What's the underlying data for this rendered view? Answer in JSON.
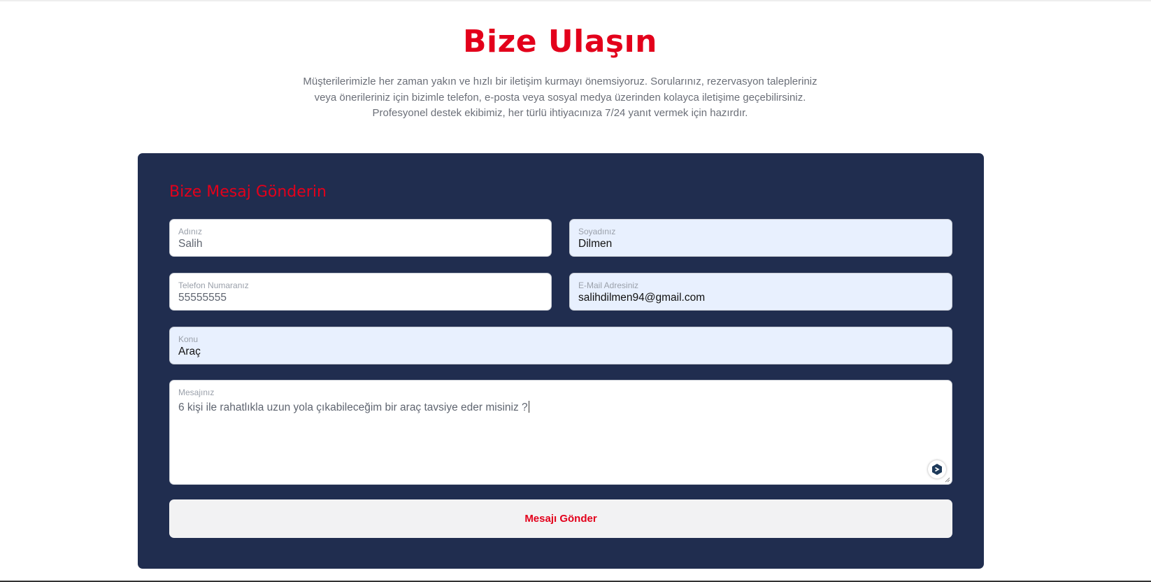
{
  "header": {
    "title": "Bize Ulaşın",
    "intro_lines": [
      "Müşterilerimizle her zaman yakın ve hızlı bir iletişim kurmayı önemsiyoruz. Sorularınız, rezervasyon talepleriniz",
      "veya önerileriniz için bizimle telefon, e-posta veya sosyal medya üzerinden kolayca iletişime geçebilirsiniz.",
      "Profesyonel destek ekibimiz, her türlü ihtiyacınıza 7/24 yanıt vermek için hazırdır."
    ]
  },
  "form": {
    "title": "Bize Mesaj Gönderin",
    "first_name": {
      "label": "Adınız",
      "value": "Salih"
    },
    "last_name": {
      "label": "Soyadınız",
      "value": "Dilmen"
    },
    "phone": {
      "label": "Telefon Numaranız",
      "value": "55555555"
    },
    "email": {
      "label": "E-Mail Adresiniz",
      "value": "salihdilmen94@gmail.com"
    },
    "subject": {
      "label": "Konu",
      "value": "Araç"
    },
    "message": {
      "label": "Mesajınız",
      "value": "6 kişi ile rahatlıkla uzun yola çıkabileceğim bir araç tavsiye eder misiniz ?"
    },
    "submit_label": "Mesajı Gönder"
  },
  "colors": {
    "accent": "#e3001b",
    "card_background": "#202d4f",
    "autofill_background": "#e8f0fe",
    "button_background": "#f2f2f3"
  },
  "icons": {
    "textarea_assist": "writing-assistant-icon",
    "textarea_resize": "resize-handle-icon"
  }
}
